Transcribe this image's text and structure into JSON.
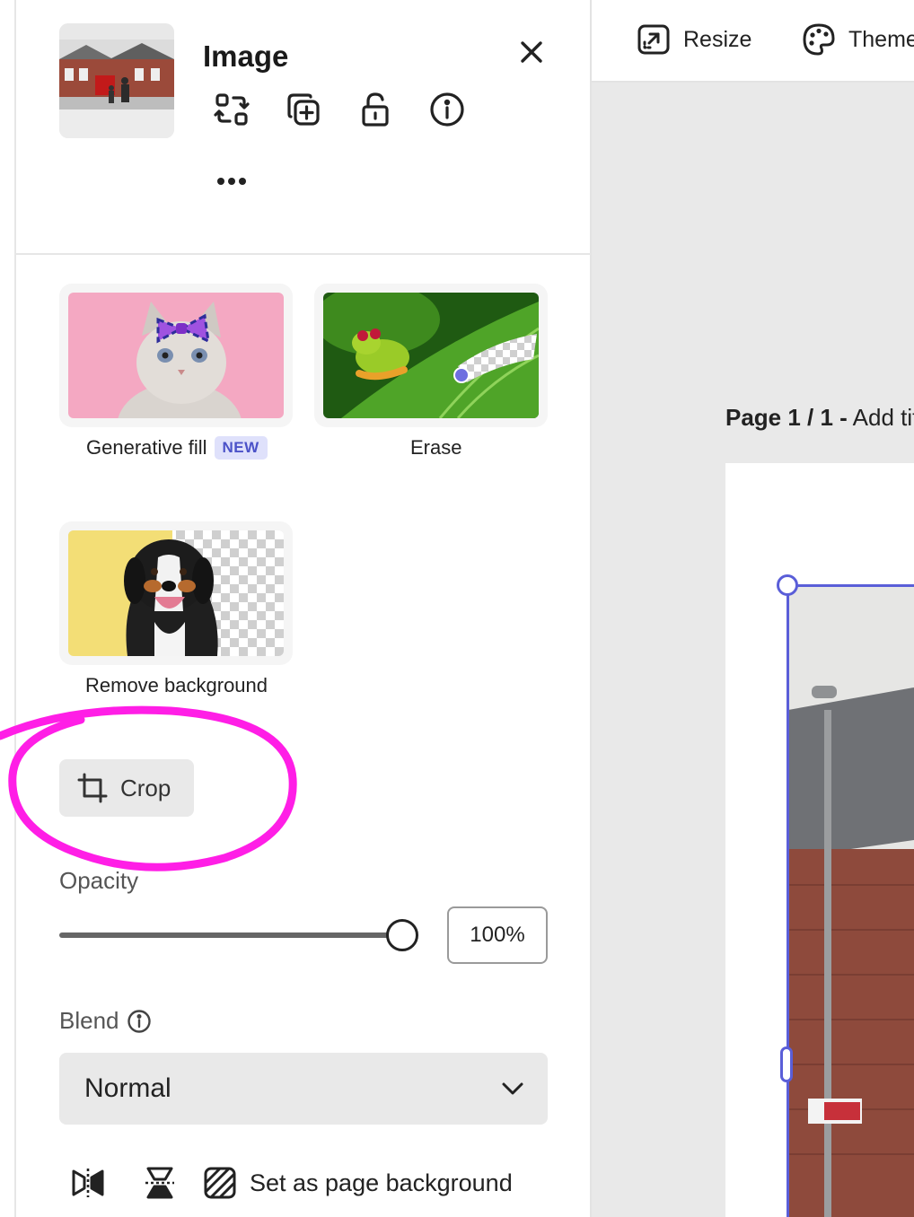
{
  "panel": {
    "title": "Image",
    "toolbar": [
      {
        "name": "replace-icon"
      },
      {
        "name": "duplicate-icon"
      },
      {
        "name": "unlock-icon"
      },
      {
        "name": "info-icon"
      }
    ],
    "more_icon": "more-icon",
    "close_icon": "close-icon"
  },
  "quick_actions": [
    {
      "label": "Generative fill",
      "badge": "NEW"
    },
    {
      "label": "Erase"
    },
    {
      "label": "Remove background"
    }
  ],
  "crop": {
    "label": "Crop"
  },
  "opacity": {
    "label": "Opacity",
    "value_text": "100%",
    "value": 1.0
  },
  "blend": {
    "label": "Blend",
    "value": "Normal"
  },
  "bottom_actions": {
    "flip_horizontal_icon": "flip-horizontal-icon",
    "flip_vertical_icon": "flip-vertical-icon",
    "set_background_label": "Set as page background"
  },
  "topbar": {
    "resize_label": "Resize",
    "theme_label": "Theme"
  },
  "page": {
    "prefix": "Page 1 / 1 -",
    "title_placeholder": "Add title"
  },
  "colors": {
    "accent": "#5a5ed8",
    "highlight": "#ff1ee6",
    "badge_bg": "#dfe1fb",
    "badge_text": "#4b52c8"
  }
}
